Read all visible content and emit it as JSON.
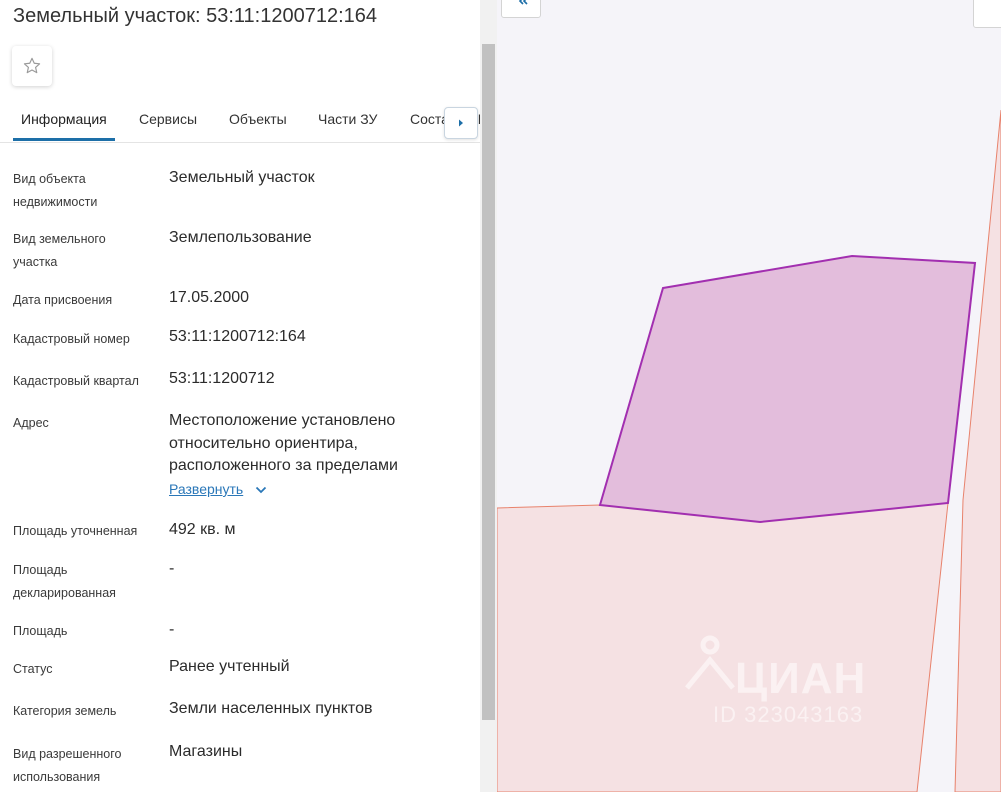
{
  "header": {
    "title": "Земельный участок: 53:11:1200712:164"
  },
  "favorite": {
    "icon": "star-outline-icon"
  },
  "tabs": [
    {
      "label": "Информация",
      "active": true
    },
    {
      "label": "Сервисы"
    },
    {
      "label": "Объекты"
    },
    {
      "label": "Части ЗУ"
    },
    {
      "label": "Состав ЕЗП"
    }
  ],
  "info": {
    "kind_label": "Вид объекта недвижимости",
    "kind_value": "Земельный участок",
    "land_type_label": "Вид земельного участка",
    "land_type_value": "Землепользование",
    "date_label": "Дата присвоения",
    "date_value": "17.05.2000",
    "cad_num_label": "Кадастровый номер",
    "cad_num_value": "53:11:1200712:164",
    "cad_quarter_label": "Кадастровый квартал",
    "cad_quarter_value": "53:11:1200712",
    "address_label": "Адрес",
    "address_value": "Местоположение установлено относительно ориентира, расположенного за пределами",
    "expand_label": "Развернуть",
    "area_precise_label": "Площадь уточненная",
    "area_precise_value": "492 кв. м",
    "area_declared_label": "Площадь декларированная",
    "area_declared_value": "-",
    "area_label": "Площадь",
    "area_value": "-",
    "status_label": "Статус",
    "status_value": "Ранее учтенный",
    "category_label": "Категория земель",
    "category_value": "Земли населенных пунктов",
    "permitted_use_label": "Вид разрешенного использования",
    "permitted_use_value": "Магазины"
  },
  "map": {
    "collapse_icon": "double-chevron-left-icon",
    "watermark_brand": "ЦИАН",
    "watermark_id": "ID 323043163",
    "colors": {
      "background": "#f5f4f9",
      "parcel_fill": "#e3bddc",
      "parcel_stroke": "#a22fb0",
      "neighbor_fill": "#f5e1e3",
      "neighbor_stroke": "#e8826c"
    }
  }
}
